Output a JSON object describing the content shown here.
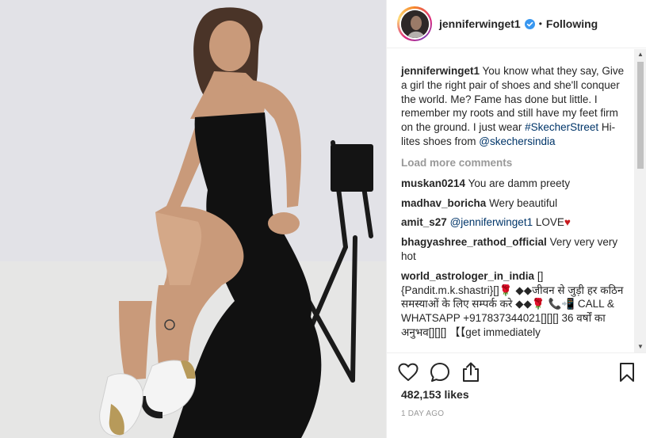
{
  "post": {
    "username": "jenniferwinget1",
    "separator": "•",
    "follow_state": "Following",
    "caption": {
      "username": "jenniferwinget1",
      "text_part1": "You know what they say, Give a girl the right pair of shoes and she'll conquer the world. Me? Fame has done but little. I remember my roots and still have my feet firm on the ground. I just wear ",
      "hashtag": "#SkecherStreet",
      "text_part2": " Hi-lites shoes from ",
      "mention": "@skechersindia"
    },
    "load_more_label": "Load more comments",
    "comments": [
      {
        "username": "muskan0214",
        "text": "You are damm preety"
      },
      {
        "username": "madhav_boricha",
        "text": "Wery beautiful"
      },
      {
        "username": "amit_s27",
        "mention": "@jenniferwinget1",
        "text": " LOVE",
        "emoji": "♥"
      },
      {
        "username": "bhagyashree_rathod_official",
        "text": "Very very very hot"
      },
      {
        "username": "world_astrologer_in_india",
        "text": "[] {Pandit.m.k.shastri}[]🌹 ◆◆जीवन से जुड़ी हर कठिन समस्याओं के लिए सम्पर्क करे ◆◆🌹 📞📲 CALL & WHATSAPP +917837344021[][][] 36 वर्षों का अनुभव[][][] 【【get immediately"
      }
    ],
    "likes": "482,153 likes",
    "timestamp": "1 DAY AGO"
  },
  "icons": {
    "like": "heart-outline-icon",
    "comment": "speech-bubble-icon",
    "share": "share-icon",
    "save": "bookmark-icon",
    "verified": "verified-badge-icon"
  },
  "colors": {
    "text": "#262626",
    "link": "#003569",
    "muted": "#999999",
    "verified": "#3897f0",
    "heart": "#c7191e"
  }
}
